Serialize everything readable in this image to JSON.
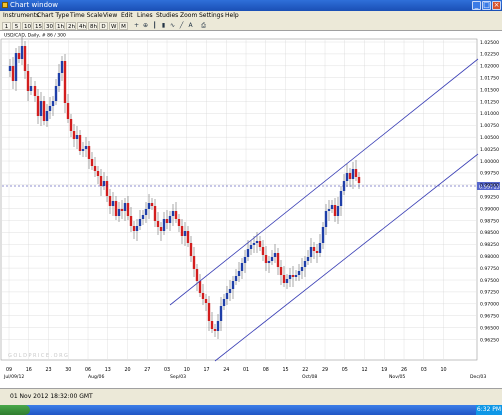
{
  "window": {
    "title": "Chart window"
  },
  "menu": [
    "Instruments",
    "Chart Type",
    "Time Scale",
    "View",
    "Edit",
    "Lines",
    "Studies",
    "Zoom",
    "Settings",
    "Help"
  ],
  "toolbar": {
    "timeframes": [
      "1",
      "5",
      "10",
      "15",
      "30",
      "1h",
      "2h",
      "4h",
      "8h",
      "D",
      "W",
      "M"
    ],
    "icons": [
      "crosshair-icon",
      "zoom-in-icon",
      "bar-chart-icon",
      "candle-chart-icon",
      "line-chart-icon",
      "trend-line-icon",
      "text-icon",
      "print-icon"
    ]
  },
  "chart": {
    "symbol_label": "USD/CAD, Daily, # 86 / 300",
    "price_axis": [
      "1.02500",
      "1.02250",
      "1.02000",
      "1.01750",
      "1.01500",
      "1.01250",
      "1.01000",
      "1.00750",
      "1.00500",
      "1.00250",
      "1.00000",
      "0.99750",
      "0.99500",
      "0.99250",
      "0.99000",
      "0.98750",
      "0.98500",
      "0.98250",
      "0.98000",
      "0.97750",
      "0.97500",
      "0.97250",
      "0.97000",
      "0.96750",
      "0.96500",
      "0.96250"
    ],
    "date_ticks": [
      "09",
      "16",
      "23",
      "30",
      "06",
      "13",
      "20",
      "27",
      "03",
      "10",
      "17",
      "24",
      "01",
      "08",
      "15",
      "22",
      "29",
      "05",
      "12",
      "19",
      "26",
      "03",
      "10"
    ],
    "month_labels": [
      "Jul/09/12",
      "Aug/06",
      "Sep/03",
      "Oct/08",
      "Nov/05",
      "Dec/03"
    ],
    "current_price": "0.99713",
    "watermark": "GOLDPRICE.ORG",
    "colors": {
      "up": "#1f3fa8",
      "down": "#d21e1e",
      "channel": "#3a3fb5",
      "price_line": "#2323a0",
      "grid": "#d8d8d8"
    }
  },
  "status": {
    "timestamp": "01 Nov 2012  18:32:00 GMT"
  },
  "taskbar": {
    "clock": "6:32 PM"
  }
}
